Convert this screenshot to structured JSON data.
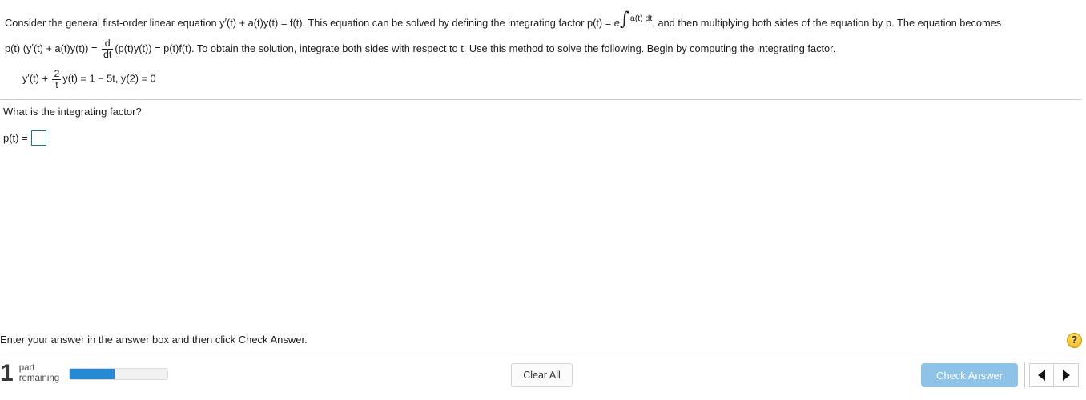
{
  "problem": {
    "paragraph_line1_a": "Consider the general first-order linear equation y",
    "paragraph_line1_b": "(t) + a(t)y(t) = f(t). This equation can be solved by defining the integrating factor p(t) = ",
    "exponent_e": "e",
    "integral_sign": "∫",
    "integral_body": "a(t) dt",
    "paragraph_line1_c": ", and then multiplying both sides of the equation by p. The equation becomes",
    "paragraph_line2_a": "p(t) (y",
    "paragraph_line2_b": "(t) + a(t)y(t))  = ",
    "ddt_numerator": "d",
    "ddt_denominator": "dt",
    "paragraph_line2_c": "(p(t)y(t)) = p(t)f(t). To obtain the solution, integrate both sides with respect to t. Use this method to solve the following. Begin by computing the integrating factor.",
    "prime_mark": "′"
  },
  "given_equation": {
    "lead": "y",
    "prime_mark": "′",
    "after_prime": "(t) + ",
    "frac_numerator": "2",
    "frac_denominator": "t",
    "tail": "y(t) = 1 − 5t, y(2) = 0"
  },
  "question": {
    "text": "What is the integrating factor?",
    "answer_label": "p(t) =",
    "answer_value": "",
    "answer_placeholder": ""
  },
  "instruction": {
    "text": "Enter your answer in the answer box and then click Check Answer.",
    "help_icon": "?"
  },
  "footer": {
    "parts_count": "1",
    "parts_label_line1": "part",
    "parts_label_line2": "remaining",
    "progress_percent": 46,
    "clear_all_label": "Clear All",
    "check_answer_label": "Check Answer",
    "prev_icon": "triangle-left-icon",
    "next_icon": "triangle-right-icon"
  },
  "colors": {
    "progress_fill": "#2589d4",
    "check_answer_bg": "#8ec2e6",
    "answer_box_border": "#0f7a8c",
    "help_button_bg": "#f7c93f",
    "divider": "#c8ccd4"
  }
}
